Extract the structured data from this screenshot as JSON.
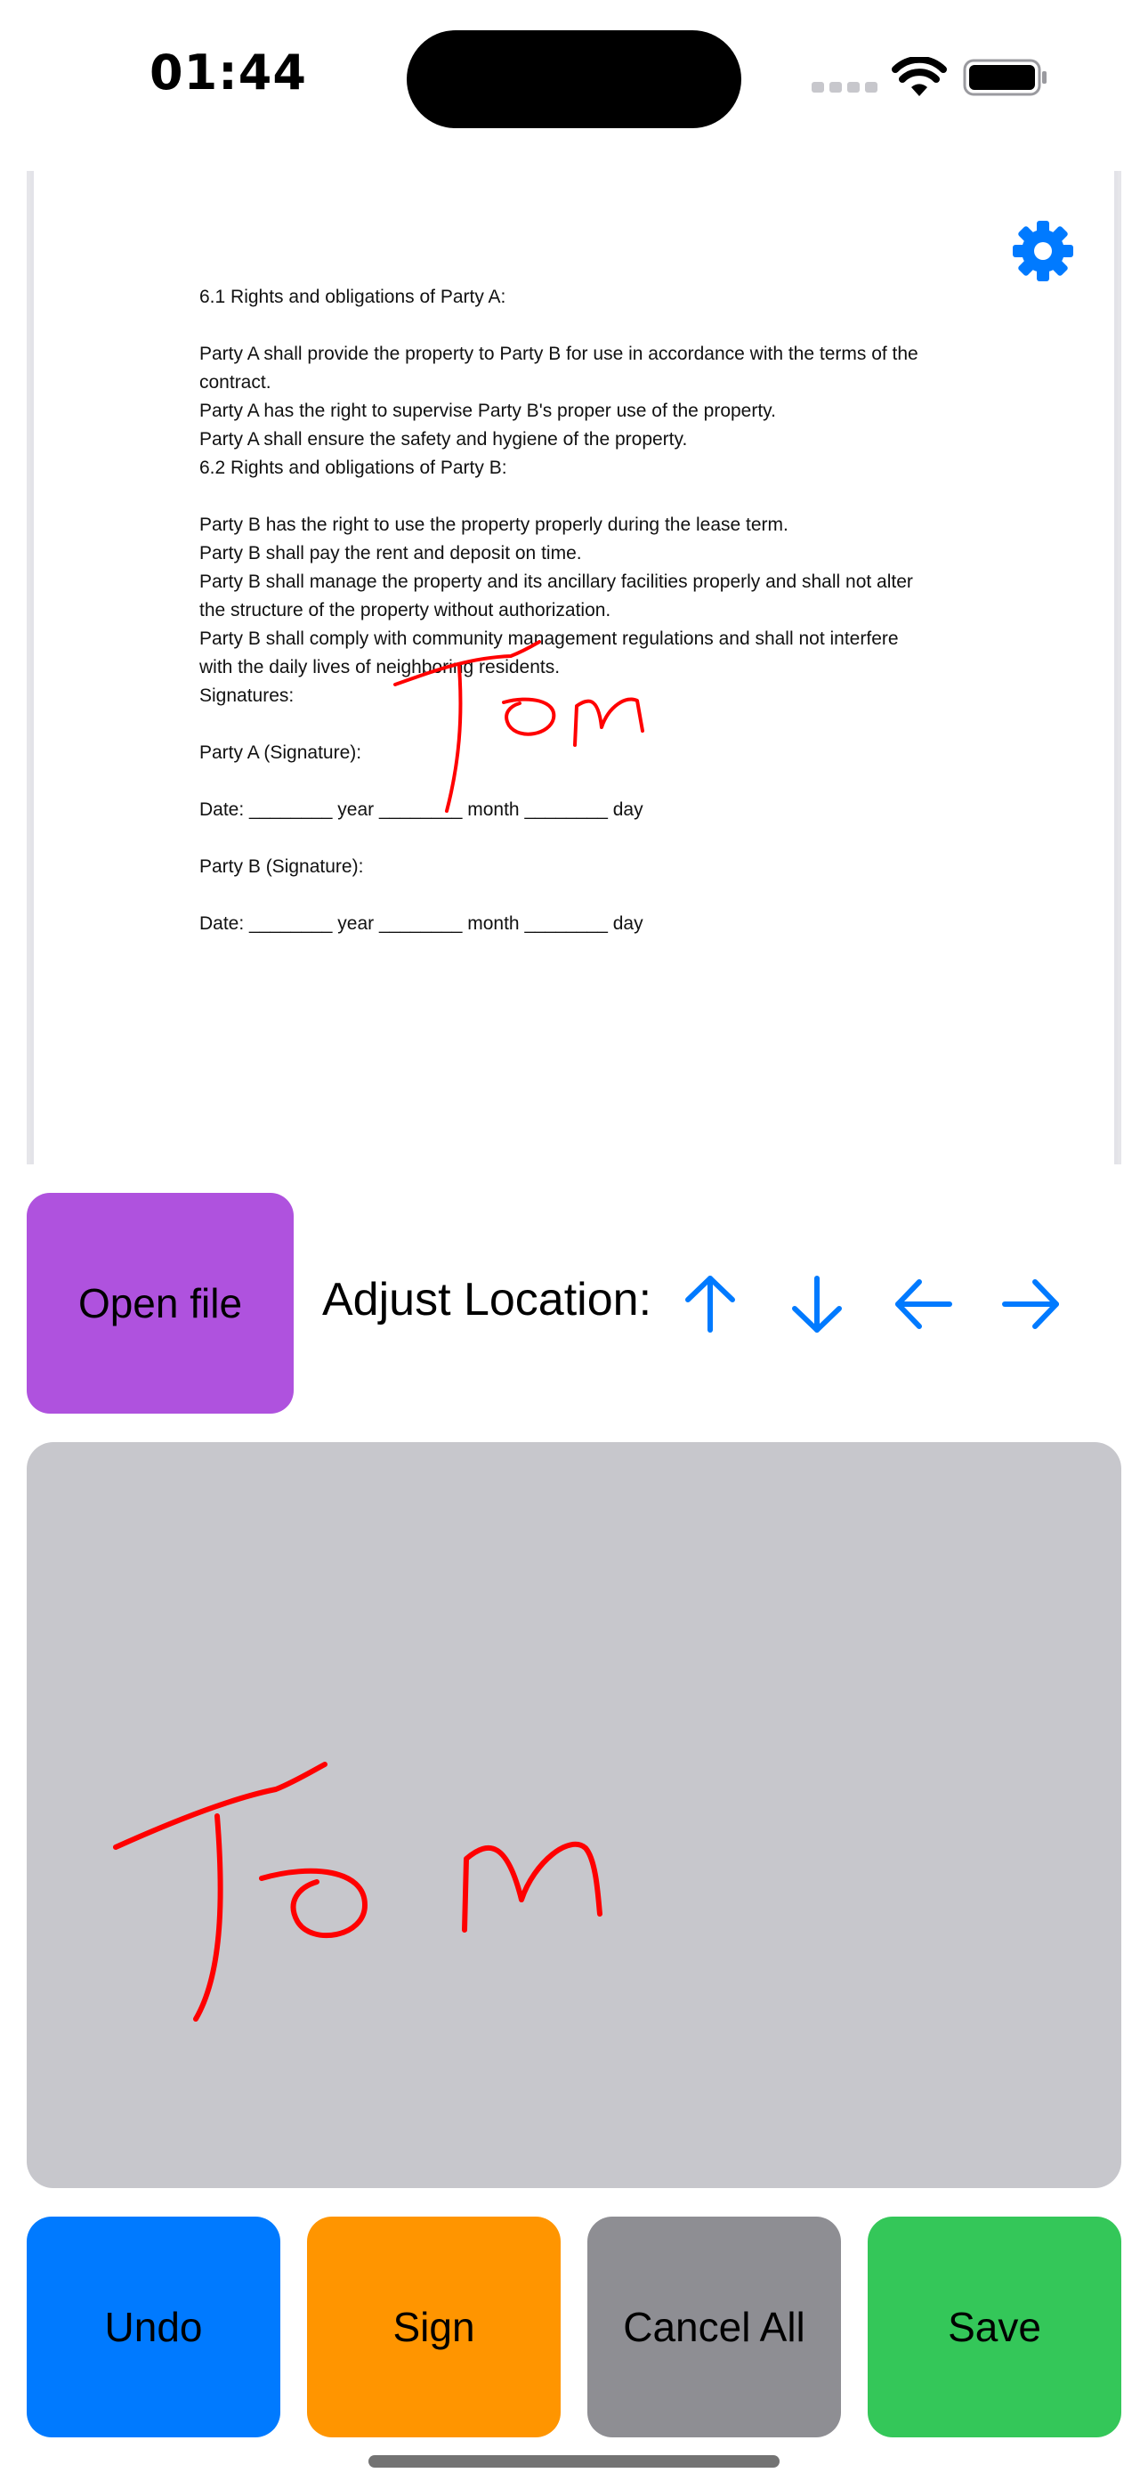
{
  "status_bar": {
    "time": "01:44"
  },
  "document": {
    "lines": [
      "6.1 Rights and obligations of Party A:",
      "",
      "Party A shall provide the property to Party B for use in accordance with the terms of the",
      "contract.",
      "Party A has the right to supervise Party B's proper use of the property.",
      "Party A shall ensure the safety and hygiene of the property.",
      "6.2 Rights and obligations of Party B:",
      "",
      "Party B has the right to use the property properly during the lease term.",
      "Party B shall pay the rent and deposit on time.",
      "Party B shall manage the property and its ancillary facilities properly and shall not alter",
      "the structure of the property without authorization.",
      "Party B shall comply with community management regulations and shall not interfere",
      "with the daily lives of neighboring residents.",
      "Signatures:",
      "",
      "Party A (Signature):",
      "",
      "Date: ________ year ________ month ________ day",
      "",
      "Party B (Signature):",
      "",
      "Date: ________ year ________ month ________ day"
    ]
  },
  "controls": {
    "open_file_label": "Open file",
    "adjust_location_label": "Adjust Location:"
  },
  "icons": {
    "settings": "gear-icon",
    "up": "arrow-up-icon",
    "down": "arrow-down-icon",
    "left": "arrow-left-icon",
    "right": "arrow-right-icon"
  },
  "buttons": {
    "undo": "Undo",
    "sign": "Sign",
    "cancel_all": "Cancel All",
    "save": "Save"
  },
  "colors": {
    "accent_blue": "#007aff",
    "open_file": "#af52de",
    "sign": "#ff9500",
    "cancel_all": "#8e8e93",
    "save": "#34c759",
    "signature_ink": "#ff0000",
    "pad_background": "#c7c7cc"
  }
}
